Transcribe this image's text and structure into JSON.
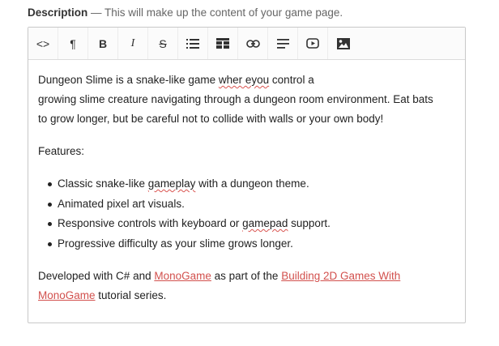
{
  "field": {
    "label": "Description",
    "hint": " — This will make up the content of your game page."
  },
  "toolbar": {
    "buttons": [
      {
        "name": "html-source-button",
        "label": "<>"
      },
      {
        "name": "paragraph-button",
        "label": "¶"
      },
      {
        "name": "bold-button",
        "label": "B"
      },
      {
        "name": "italic-button",
        "label": "I"
      },
      {
        "name": "strikethrough-button",
        "label": "S"
      }
    ]
  },
  "content": {
    "intro_line1_a": "Dungeon Slime is a snake-like game ",
    "intro_line1_misspell": "wher eyou",
    "intro_line1_b": " control a",
    "intro_line2": "growing slime creature navigating through a dungeon room environment.  Eat bats",
    "intro_line3": "to grow longer, but be careful not to collide with walls or your own body!",
    "features_heading": "Features:",
    "features": [
      {
        "pre": "Classic snake-like ",
        "spell": "gameplay",
        "post": " with a dungeon theme."
      },
      {
        "pre": "Animated pixel art visuals.",
        "spell": "",
        "post": ""
      },
      {
        "pre": "Responsive controls with keyboard or ",
        "spell": "gamepad",
        "post": " support."
      },
      {
        "pre": "Progressive difficulty as your slime grows longer.",
        "spell": "",
        "post": ""
      }
    ],
    "credits_pre": "Developed with C# and ",
    "credits_link1": "MonoGame",
    "credits_mid": " as part of the ",
    "credits_link2": "Building 2D Games With MonoGame",
    "credits_link2_line1": "Building 2D Games With",
    "credits_link2_line2": "MonoGame",
    "credits_post": " tutorial series."
  },
  "colors": {
    "link": "#d2504d",
    "spellcheck": "#d9534f"
  }
}
